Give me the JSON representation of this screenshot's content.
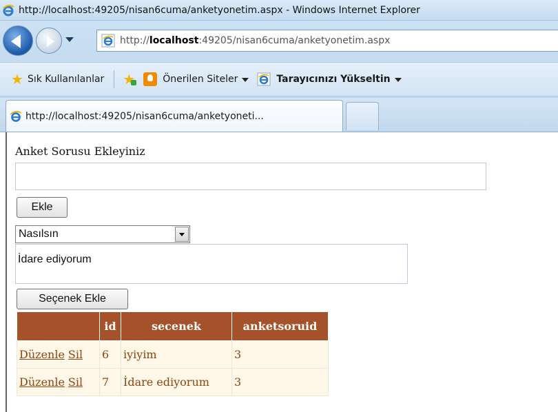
{
  "window": {
    "title": "http://localhost:49205/nisan6cuma/anketyonetim.aspx - Windows Internet Explorer"
  },
  "address_bar": {
    "url_prefix": "http://",
    "url_host": "localhost",
    "url_rest": ":49205/nisan6cuma/anketyonetim.aspx"
  },
  "favorites_bar": {
    "favorites_label": "Sık Kullanılanlar",
    "suggested_sites_label": "Önerilen Siteler",
    "upgrade_label": "Tarayıcınızı Yükseltin"
  },
  "tabs": [
    {
      "label": "http://localhost:49205/nisan6cuma/anketyoneti..."
    }
  ],
  "page": {
    "question_label": "Anket Sorusu Ekleyiniz",
    "question_value": "",
    "add_button": "Ekle",
    "selected_question": "Nasılsın",
    "option_value": "İdare ediyorum",
    "add_option_button": "Seçenek Ekle",
    "grid": {
      "headers": [
        "",
        "id",
        "secenek",
        "anketsoruid"
      ],
      "edit_label": "Düzenle",
      "delete_label": "Sil",
      "rows": [
        {
          "id": "6",
          "secenek": "iyiyim",
          "anketsoruid": "3"
        },
        {
          "id": "7",
          "secenek": "İdare ediyorum",
          "anketsoruid": "3"
        }
      ]
    }
  },
  "colors": {
    "grid_header_bg": "#a55129",
    "grid_row_bg": "#fff7e7",
    "grid_text": "#8c4510"
  },
  "icons": [
    "ie-logo-icon",
    "back-arrow-icon",
    "forward-arrow-icon",
    "favorites-star-icon",
    "add-favorite-icon",
    "suggested-sites-icon",
    "ie-page-icon",
    "dropdown-arrow-icon"
  ]
}
